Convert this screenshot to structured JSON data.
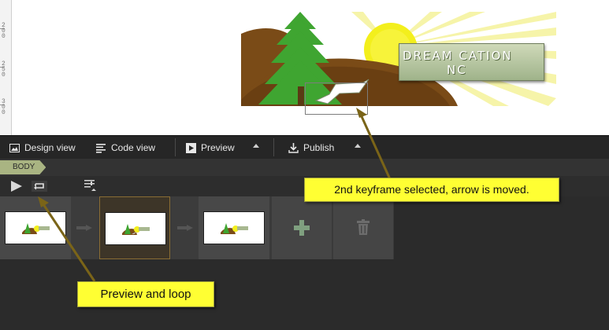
{
  "ruler": {
    "labels": [
      "200",
      "250",
      "300"
    ]
  },
  "stage": {
    "banner_line1": "DREAM  CATION",
    "banner_line2": "NC"
  },
  "toolbar": {
    "design_view": "Design view",
    "code_view": "Code view",
    "preview": "Preview",
    "publish": "Publish"
  },
  "tagbar": {
    "body_tag": "BODY"
  },
  "filmstrip": {
    "keyframes": [
      {
        "label": "keyframe 1",
        "selected": false
      },
      {
        "label": "keyframe 2",
        "selected": true
      },
      {
        "label": "keyframe 3",
        "selected": false
      }
    ]
  },
  "callouts": {
    "keyframe": "2nd keyframe selected, arrow is moved.",
    "preview": "Preview and loop"
  },
  "colors": {
    "accent_tag": "#a9b482",
    "callout_bg": "#ffff33",
    "annotation_arrow": "#7a6418",
    "selected_frame_border": "#8a6d34"
  }
}
